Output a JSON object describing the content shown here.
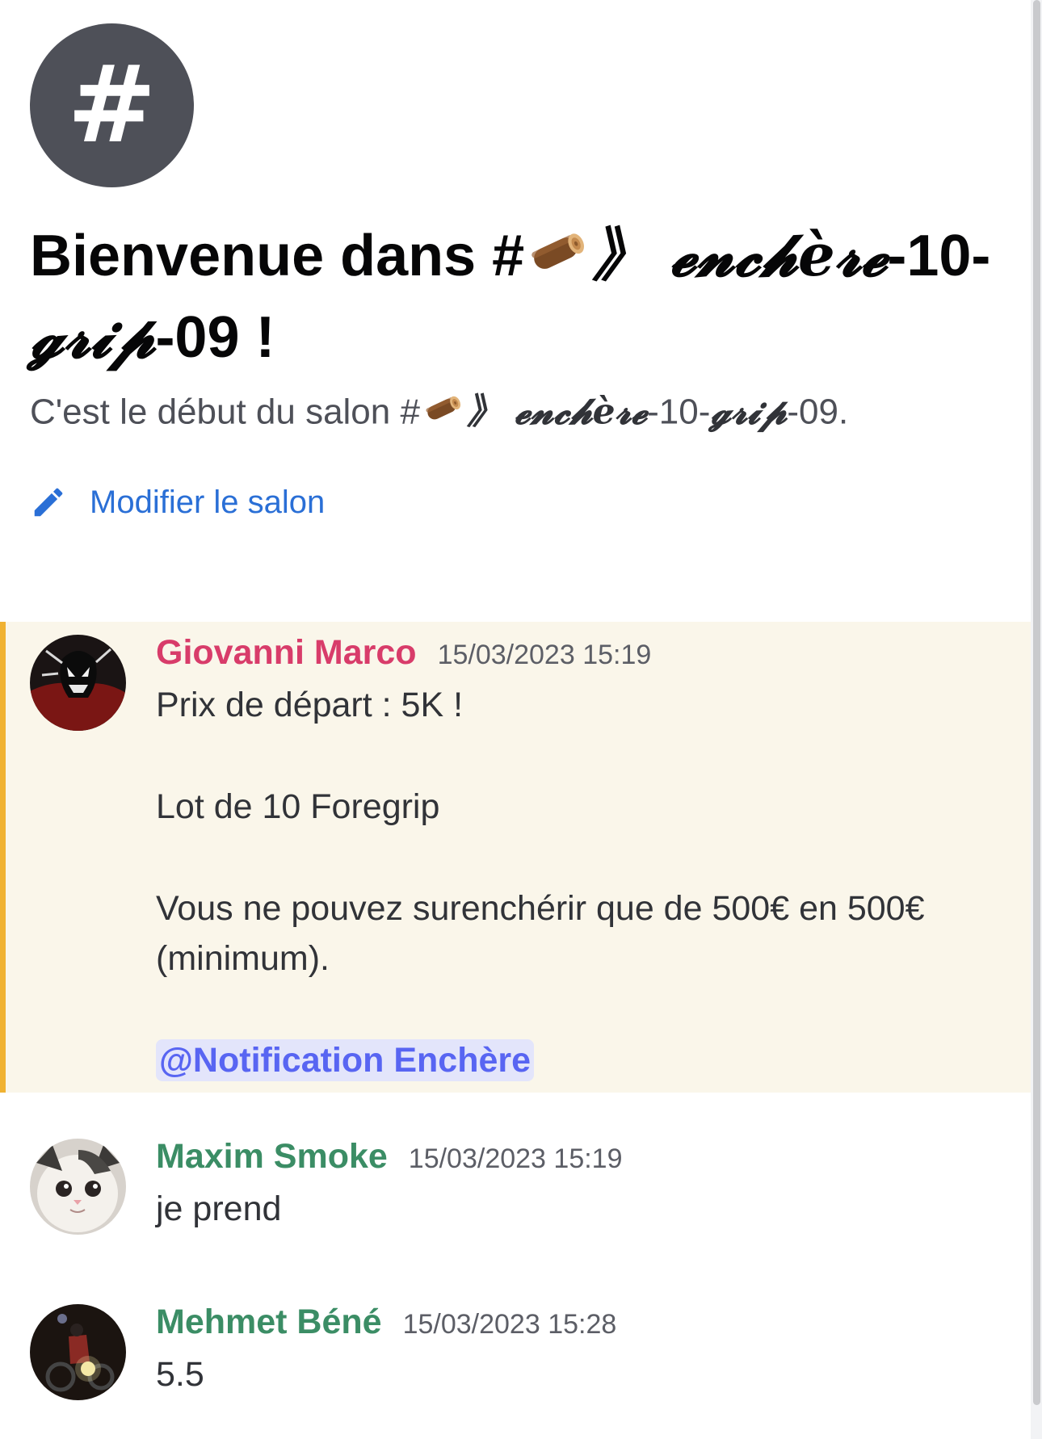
{
  "channel": {
    "avatar_glyph": "#",
    "welcome_prefix": "Bienvenue dans #",
    "channel_name_fancy": "》 𝓮𝓷𝓬𝓱è𝓻𝓮",
    "channel_name_rest_1": "-10-",
    "channel_name_fancy_2": "𝓰𝓻𝓲𝓹",
    "channel_name_rest_2": "-09 !",
    "start_prefix": "C'est le début du salon #",
    "start_fancy": "》 𝓮𝓷𝓬𝓱è𝓻𝓮",
    "start_rest_1": "-10-",
    "start_fancy_2": "𝓰𝓻𝓲𝓹",
    "start_rest_2": "-09.",
    "edit_label": "Modifier le salon",
    "emoji": "wood-log-icon"
  },
  "messages": [
    {
      "author": "Giovanni Marco",
      "author_color": "#d83c6a",
      "timestamp": "15/03/2023 15:19",
      "lines": [
        "Prix de départ : 5K !",
        "Lot de 10 Foregrip",
        "Vous ne pouvez surenchérir que de 500€ en 500€ (minimum)."
      ],
      "mention": "@Notification Enchère",
      "highlighted": true
    },
    {
      "author": "Maxim Smoke",
      "author_color": "#3b8d65",
      "timestamp": "15/03/2023 15:19",
      "lines": [
        "je prend"
      ]
    },
    {
      "author": "Mehmet Béné",
      "author_color": "#3b8d65",
      "timestamp": "15/03/2023 15:28",
      "lines": [
        "5.5"
      ]
    }
  ]
}
